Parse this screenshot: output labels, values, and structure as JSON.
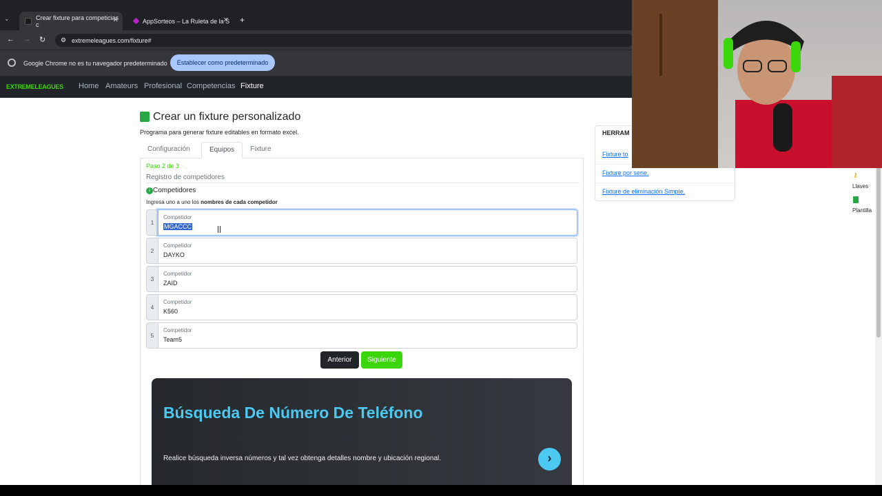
{
  "browser": {
    "tabs": [
      {
        "title": "Crear fixture para competicias c",
        "active": true
      },
      {
        "title": "AppSorteos – La Ruleta de la S",
        "active": false
      }
    ],
    "url": "extremeleagues.com/fixture#",
    "infobar_text": "Google Chrome no es tu navegador predeterminado",
    "infobar_button": "Establecer como predeterminado"
  },
  "site": {
    "logo": "EXTREMELEAGUES",
    "nav": [
      "Home",
      "Amateurs",
      "Profesional",
      "Competencias",
      "Fixture"
    ]
  },
  "page": {
    "title": "Crear un fixture personalizado",
    "subtitle": "Programa para generar fixture editables en formato excel.",
    "tabs": [
      "Configuración",
      "Equipos",
      "Fixture"
    ],
    "step": "Paso 2 de 3",
    "section": "Registro de competidores",
    "heading": "Competidores",
    "hint_prefix": "Ingresa uno a uno los ",
    "hint_bold": "nombres de cada competidor",
    "field_label": "Competidor",
    "competitors": [
      {
        "n": "1",
        "value": "MGACCC"
      },
      {
        "n": "2",
        "value": "DAYKO"
      },
      {
        "n": "3",
        "value": "ZAID"
      },
      {
        "n": "4",
        "value": "K560"
      },
      {
        "n": "5",
        "value": "Team5"
      }
    ],
    "btn_prev": "Anterior",
    "btn_next": "Siguiente"
  },
  "ad": {
    "title": "Búsqueda De Número De Teléfono",
    "text": "Realice búsqueda inversa números y tal vez obtenga detalles nombre y ubicación regional.",
    "arrow": "›"
  },
  "tools": {
    "title": "HERRAM",
    "links": [
      "Fixture to",
      "Fixture por serie.",
      "Fixture de eliminación Simple."
    ]
  },
  "side": {
    "llaves": "Llaves",
    "plantilla": "Plantilla"
  },
  "colors": {
    "accent": "#3cd60c",
    "link": "#0d6efd",
    "ad_title": "#4cc9f0"
  }
}
